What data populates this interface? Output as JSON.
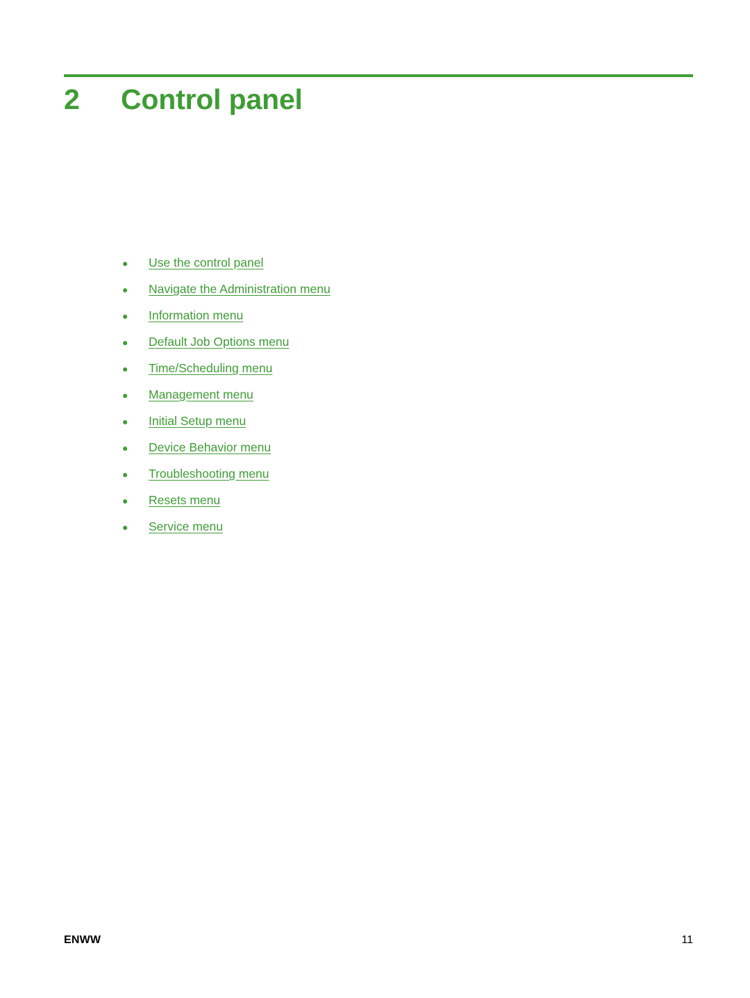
{
  "chapter": {
    "number": "2",
    "title": "Control panel",
    "accent_color": "#3f9c35"
  },
  "toc": {
    "bullet": "●",
    "items": [
      {
        "label": "Use the control panel"
      },
      {
        "label": "Navigate the Administration menu"
      },
      {
        "label": "Information menu"
      },
      {
        "label": "Default Job Options menu"
      },
      {
        "label": "Time/Scheduling menu"
      },
      {
        "label": "Management menu"
      },
      {
        "label": "Initial Setup menu"
      },
      {
        "label": "Device Behavior menu"
      },
      {
        "label": "Troubleshooting menu"
      },
      {
        "label": "Resets menu"
      },
      {
        "label": "Service menu"
      }
    ]
  },
  "footer": {
    "left": "ENWW",
    "page_number": "11"
  }
}
